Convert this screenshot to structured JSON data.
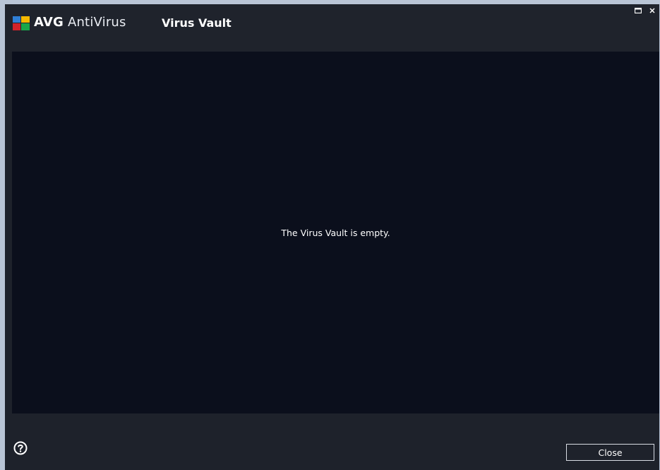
{
  "window": {
    "brand_bold": "AVG",
    "brand_light": "AntiVirus",
    "section_title": "Virus Vault",
    "controls": {
      "restore_icon": "restore-icon",
      "close_icon": "close-icon"
    }
  },
  "content": {
    "empty_message": "The Virus Vault is empty."
  },
  "footer": {
    "help_icon": "help-icon",
    "close_label": "Close"
  },
  "colors": {
    "background": "#1e222b",
    "content_background": "#0b0f1c",
    "frame": "#b9c5d6",
    "text": "#ffffff"
  }
}
